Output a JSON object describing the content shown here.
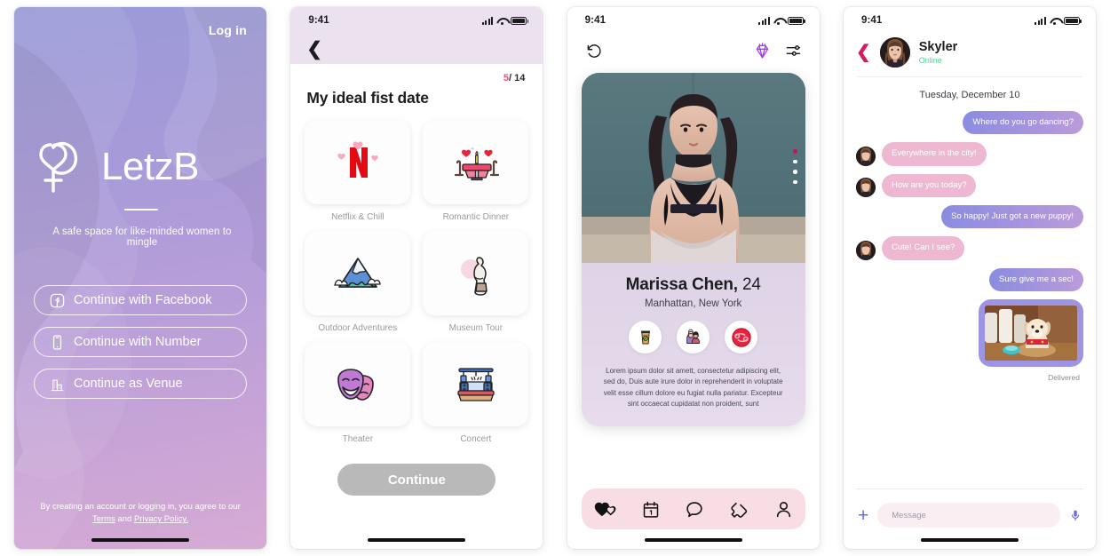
{
  "status_bar": {
    "time": "9:41",
    "signal_icon": "cellular-bars-icon",
    "wifi_icon": "wifi-icon",
    "battery_icon": "battery-icon"
  },
  "colors": {
    "brand_purple": "#9a9ad8",
    "brand_pink": "#d6aad4",
    "accent_magenta": "#e8547d",
    "online_green": "#49d68e",
    "bubble_me": "#9d94e3",
    "bubble_them": "#eeb8d3",
    "tabbar_pink": "#f8dde4"
  },
  "onboarding": {
    "login_label": "Log in",
    "brand_name": "LetzB",
    "logo_icon": "venus-heart-logo-icon",
    "tagline": "A safe space for like-minded women to mingle",
    "buttons": [
      {
        "label": "Continue with Facebook",
        "icon": "facebook-icon"
      },
      {
        "label": "Continue with Number",
        "icon": "phone-icon"
      },
      {
        "label": "Continue as Venue",
        "icon": "building-icon"
      }
    ],
    "legal_prefix": "By creating an account or logging in, you agree to our ",
    "legal_terms": "Terms",
    "legal_and": " and ",
    "legal_privacy": "Privacy Policy."
  },
  "picker": {
    "back_icon": "chevron-left-icon",
    "step_current": "5",
    "step_total": "/ 14",
    "title": "My ideal fist date",
    "options": [
      {
        "label": "Netflix & Chill",
        "icon": "netflix-hearts-icon"
      },
      {
        "label": "Romantic Dinner",
        "icon": "candlelit-table-icon"
      },
      {
        "label": "Outdoor Adventures",
        "icon": "mountain-icon"
      },
      {
        "label": "Museum Tour",
        "icon": "statue-icon"
      },
      {
        "label": "Theater",
        "icon": "theater-masks-icon"
      },
      {
        "label": "Concert",
        "icon": "concert-stage-icon"
      }
    ],
    "continue_label": "Continue"
  },
  "discover": {
    "rewind_icon": "rewind-icon",
    "premium_icon": "diamond-icon",
    "filter_icon": "sliders-icon",
    "photo_dots": 4,
    "photo_active_dot": 1,
    "name": "Marissa Chen,",
    "age": "24",
    "location": "Manhattan, New York",
    "badges": [
      {
        "icon": "coffee-cup-icon"
      },
      {
        "icon": "couple-kissing-icon"
      },
      {
        "icon": "cancer-zodiac-icon"
      }
    ],
    "bio": "Lorem ipsum dolor sit amett, consectetur adipiscing elit, sed do, Duis aute irure dolor in reprehenderit in voluptate velit esse cillum dolore eu fugiat nulla pariatur. Excepteur sint occaecat cupidatat non proident, sunt",
    "tabs": [
      {
        "name": "matches",
        "icon": "hearts-icon"
      },
      {
        "name": "events",
        "icon": "calendar-icon"
      },
      {
        "name": "messages",
        "icon": "chat-bubble-icon"
      },
      {
        "name": "tickets",
        "icon": "ticket-icon"
      },
      {
        "name": "profile",
        "icon": "person-icon"
      }
    ]
  },
  "chat": {
    "back_icon": "chevron-left-icon",
    "avatar_icon": "avatar",
    "name": "Skyler",
    "status": "Online",
    "date_label": "Tuesday, December 10",
    "messages": [
      {
        "side": "me",
        "type": "text",
        "text": "Where do you go dancing?"
      },
      {
        "side": "them",
        "type": "text",
        "text": "Everywhere in the city!"
      },
      {
        "side": "them",
        "type": "text",
        "text": "How are you today?"
      },
      {
        "side": "me",
        "type": "text",
        "text": "So happy! Just got a new puppy!"
      },
      {
        "side": "them",
        "type": "text",
        "text": "Cute! Can I see?"
      },
      {
        "side": "me",
        "type": "text",
        "text": "Sure give me a sec!"
      },
      {
        "side": "me",
        "type": "image",
        "text": "puppy-photo"
      }
    ],
    "delivered_label": "Delivered",
    "input_placeholder": "Message",
    "plus_icon": "plus-icon",
    "mic_icon": "microphone-icon"
  }
}
